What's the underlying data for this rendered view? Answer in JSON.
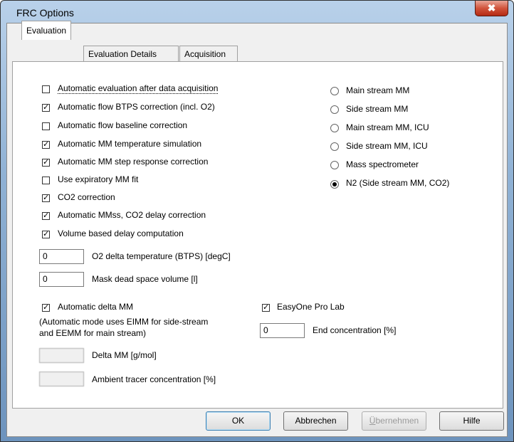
{
  "window": {
    "title": "FRC Options",
    "close_glyph": "✖"
  },
  "tabs": [
    "Evaluation",
    "Evaluation Details",
    "Acquisition"
  ],
  "checkboxes": [
    {
      "label": "Automatic evaluation after data acquisition",
      "checked": false
    },
    {
      "label": "Automatic flow BTPS correction (incl. O2)",
      "checked": true
    },
    {
      "label": "Automatic flow baseline correction",
      "checked": false
    },
    {
      "label": "Automatic MM temperature simulation",
      "checked": true
    },
    {
      "label": "Automatic MM step response correction",
      "checked": true
    },
    {
      "label": "Use expiratory MM fit",
      "checked": false
    },
    {
      "label": "CO2 correction",
      "checked": true
    },
    {
      "label": "Automatic MMss, CO2 delay correction",
      "checked": true
    },
    {
      "label": "Volume based delay computation",
      "checked": true
    }
  ],
  "radios": [
    {
      "label": "Main stream MM",
      "selected": false
    },
    {
      "label": "Side stream MM",
      "selected": false
    },
    {
      "label": "Main stream MM, ICU",
      "selected": false
    },
    {
      "label": "Side stream MM, ICU",
      "selected": false
    },
    {
      "label": "Mass spectrometer",
      "selected": false
    },
    {
      "label": "N2 (Side stream MM, CO2)",
      "selected": true
    }
  ],
  "fields": {
    "o2_delta": {
      "value": "0",
      "label": "O2 delta temperature (BTPS) [degC]"
    },
    "mask_dead": {
      "value": "0",
      "label": "Mask dead space volume [l]"
    },
    "end_conc": {
      "value": "0",
      "label": "End concentration [%]"
    },
    "delta_mm": {
      "label": "Delta MM [g/mol]"
    },
    "ambient": {
      "label": "Ambient tracer concentration [%]"
    }
  },
  "auto_delta": {
    "label": "Automatic delta MM",
    "checked": true,
    "note_line1": "(Automatic mode uses EIMM for side-stream",
    "note_line2": "and EEMM for main stream)"
  },
  "easyone": {
    "label": "EasyOne Pro Lab",
    "checked": true
  },
  "buttons": {
    "ok": "OK",
    "cancel": "Abbrechen",
    "apply_mnemonic": "Ü",
    "apply_rest": "bernehmen",
    "help": "Hilfe"
  }
}
